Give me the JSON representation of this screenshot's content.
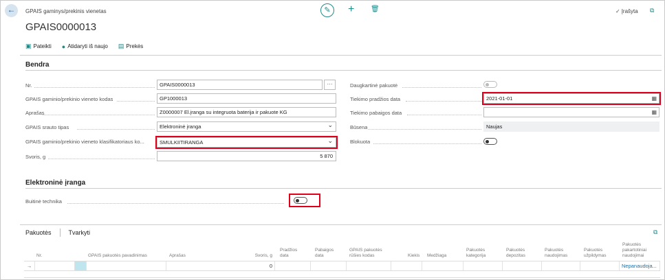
{
  "header": {
    "breadcrumb": "GPAIS gaminys/prekinis vienetas",
    "record_title": "GPAIS0000013",
    "saved_label": "Įrašyta"
  },
  "actions": [
    {
      "label": "Pateikti",
      "icon": "submit-icon"
    },
    {
      "label": "Atidaryti iš naujo",
      "icon": "reopen-icon"
    },
    {
      "label": "Prekės",
      "icon": "items-icon"
    }
  ],
  "general": {
    "section_title": "Bendra",
    "no_label": "Nr.",
    "no_value": "GPAIS0000013",
    "no_more": "···",
    "code_label": "GPAIS gaminio/prekinio vieneto kodas",
    "code_value": "GP1000013",
    "desc_label": "Aprašas",
    "desc_value": "Z0000007 El.įranga su integruota baterija ir pakuote KG",
    "flow_label": "GPAIS srauto tipas",
    "flow_value": "Elektroninė įranga",
    "class_label": "GPAIS gaminio/prekinio vieneto klasifikatoriaus ko...",
    "class_value": "SMULKIITIRANGA",
    "weight_label": "Svoris, g",
    "weight_value": "5 870",
    "reusable_label": "Daugkartinė pakuotė",
    "start_label": "Tiekimo pradžios data",
    "start_value": "2021-01-01",
    "end_label": "Tiekimo pabaigos data",
    "end_value": "",
    "status_label": "Būsena",
    "status_value": "Naujas",
    "blocked_label": "Blokuota"
  },
  "electronic": {
    "section_title": "Elektroninė įranga",
    "household_label": "Buitinė technika"
  },
  "packaging": {
    "tabs": [
      "Pakuotės",
      "Tvarkyti"
    ],
    "headers": [
      "Nr.",
      "GPAIS pakuotės pavadinimas",
      "Aprašas",
      "Svoris, g",
      "Pradžios data",
      "Pabaigos data",
      "GPAIS pakuotės rūšies kodas",
      "Kiekis",
      "Medžiaga",
      "Pakuotės kategorija",
      "Pakuotės depozitas",
      "Pakuotės naudojimas",
      "Pakuotės užpildymas",
      "Pakuotės pakartotiniai naudojimai"
    ],
    "row": {
      "weight": "0",
      "reuse": "Nepanaudoja..."
    }
  },
  "colors": {
    "accent": "#1f8a8a",
    "highlight": "#e0001b"
  }
}
